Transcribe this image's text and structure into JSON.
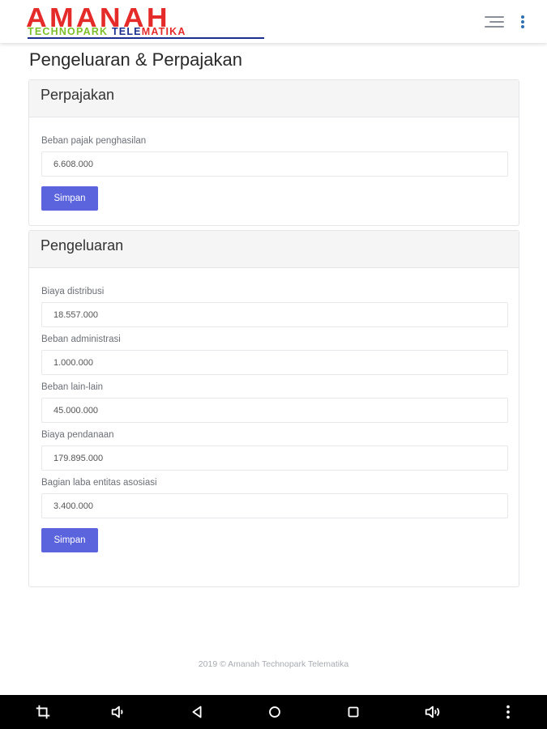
{
  "header": {
    "logo_main": "AMANAH",
    "logo_sub_1": "TECHNOPARK ",
    "logo_sub_2": "TELE",
    "logo_sub_3": "MATIKA"
  },
  "page": {
    "title": "Pengeluaran & Perpajakan"
  },
  "perpajakan": {
    "title": "Perpajakan",
    "fields": [
      {
        "label": "Beban pajak penghasilan",
        "value": "6.608.000"
      }
    ],
    "save_label": "Simpan"
  },
  "pengeluaran": {
    "title": "Pengeluaran",
    "fields": [
      {
        "label": "Biaya distribusi",
        "value": "18.557.000"
      },
      {
        "label": "Beban administrasi",
        "value": "1.000.000"
      },
      {
        "label": "Beban lain-lain",
        "value": "45.000.000"
      },
      {
        "label": "Biaya pendanaan",
        "value": "179.895.000"
      },
      {
        "label": "Bagian laba entitas asosiasi",
        "value": "3.400.000"
      }
    ],
    "save_label": "Simpan"
  },
  "footer": {
    "text": "2019 © Amanah Technopark Telematika"
  },
  "navbar": {
    "icons": [
      "crop-icon",
      "volume-down-icon",
      "back-icon",
      "home-icon",
      "recents-icon",
      "volume-up-icon",
      "more-icon"
    ]
  },
  "colors": {
    "accent": "#5b63dd",
    "logo_red": "#e52a2a",
    "logo_green": "#7cbf2a",
    "logo_blue": "#1b2f8f"
  }
}
